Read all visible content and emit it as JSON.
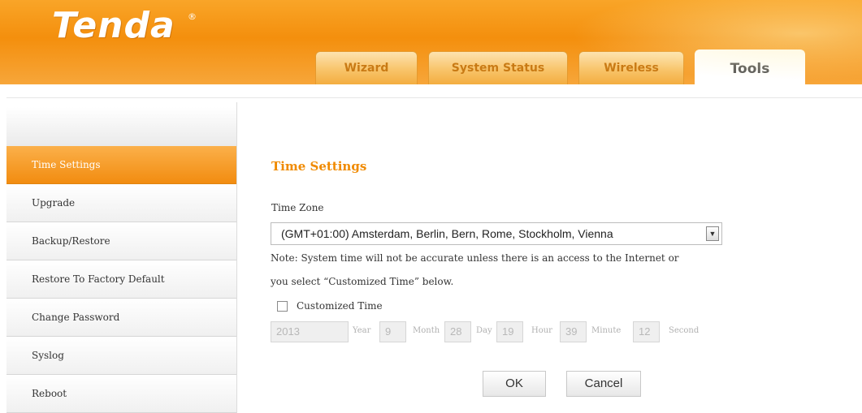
{
  "header": {
    "logo": "Tenda",
    "logo_mark": "®",
    "tabs": [
      "Wizard",
      "System Status",
      "Wireless",
      "Tools"
    ],
    "active_tab": "Tools"
  },
  "sidebar": {
    "items": [
      "Time Settings",
      "Upgrade",
      "Backup/Restore",
      "Restore To Factory Default",
      "Change Password",
      "Syslog",
      "Reboot"
    ],
    "active_item": "Time Settings"
  },
  "main": {
    "title": "Time Settings",
    "timezone_label": "Time Zone",
    "timezone_value": "(GMT+01:00) Amsterdam, Berlin, Bern, Rome, Stockholm, Vienna",
    "note_line1": "Note: System time will not be accurate unless there is an access to the Internet or",
    "note_line2": "you select “Customized Time” below.",
    "customized_label": "Customized Time",
    "customized_checked": false,
    "time": {
      "year": "2013",
      "year_unit": "Year",
      "month": "9",
      "month_unit": "Month",
      "day": "28",
      "day_unit": "Day",
      "hour": "19",
      "hour_unit": "Hour",
      "minute": "39",
      "minute_unit": "Minute",
      "second": "12",
      "second_unit": "Second"
    },
    "ok_label": "OK",
    "cancel_label": "Cancel"
  },
  "colors": {
    "brand_orange": "#f48f0d",
    "title_orange": "#f08a00",
    "disabled_text": "#b8b8b8"
  }
}
